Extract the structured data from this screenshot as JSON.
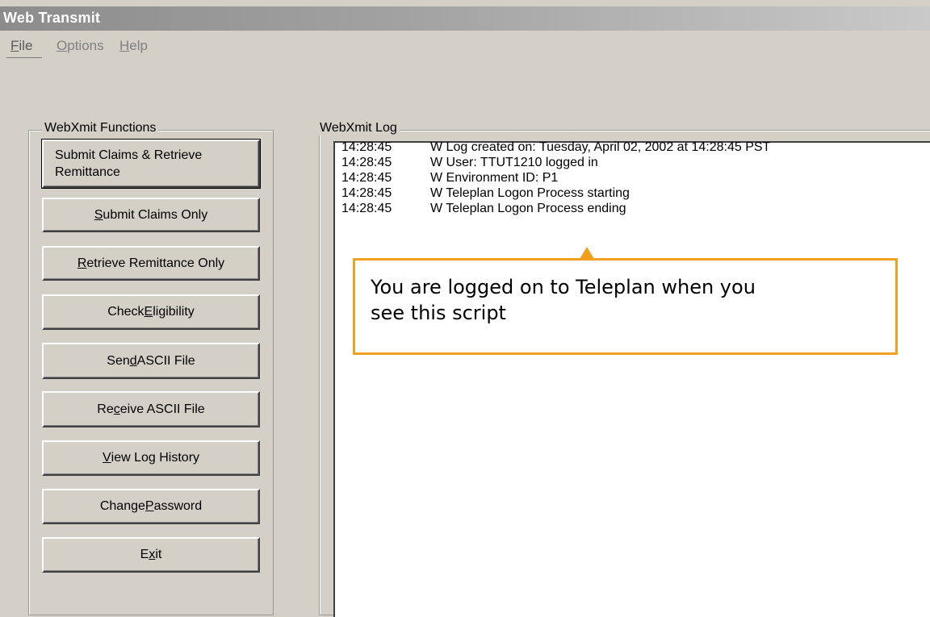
{
  "window": {
    "title": "Web Transmit"
  },
  "menu": {
    "file": {
      "mnemonic": "F",
      "rest": "ile"
    },
    "options": {
      "mnemonic": "O",
      "rest": "ptions"
    },
    "help": {
      "mnemonic": "H",
      "rest": "elp"
    }
  },
  "functions": {
    "legend": "WebXmit Functions",
    "submit_retrieve": {
      "line1": "Submit Claims &  Retrieve",
      "line2": "Remittance"
    },
    "submit_only": {
      "pre": "",
      "mnemonic": "S",
      "post": "ubmit Claims Only"
    },
    "retrieve_only": {
      "pre": "",
      "mnemonic": "R",
      "post": "etrieve Remittance Only"
    },
    "check_eligibility": {
      "pre": "Check ",
      "mnemonic": "E",
      "post": "ligibility"
    },
    "send_ascii": {
      "pre": "Sen",
      "mnemonic": "d",
      "post": " ASCII File"
    },
    "receive_ascii": {
      "pre": "Re",
      "mnemonic": "c",
      "post": "eive ASCII File"
    },
    "view_log": {
      "pre": "",
      "mnemonic": "V",
      "post": "iew Log History"
    },
    "change_password": {
      "pre": "Change ",
      "mnemonic": "P",
      "post": "assword"
    },
    "exit": {
      "pre": "E",
      "mnemonic": "x",
      "post": "it"
    }
  },
  "log": {
    "legend": "WebXmit Log",
    "entries": [
      {
        "time": "14:28:45",
        "message": "W Log created on: Tuesday, April 02, 2002 at 14:28:45 PST"
      },
      {
        "time": "14:28:45",
        "message": "W User: TTUT1210 logged in"
      },
      {
        "time": "14:28:45",
        "message": "W Environment ID: P1"
      },
      {
        "time": "14:28:45",
        "message": "W Teleplan Logon Process starting"
      },
      {
        "time": "14:28:45",
        "message": "W Teleplan Logon Process ending"
      }
    ]
  },
  "callout": {
    "line1": "You are logged on to Teleplan when you",
    "line2": "see this script",
    "border_color": "#f0a01e"
  }
}
